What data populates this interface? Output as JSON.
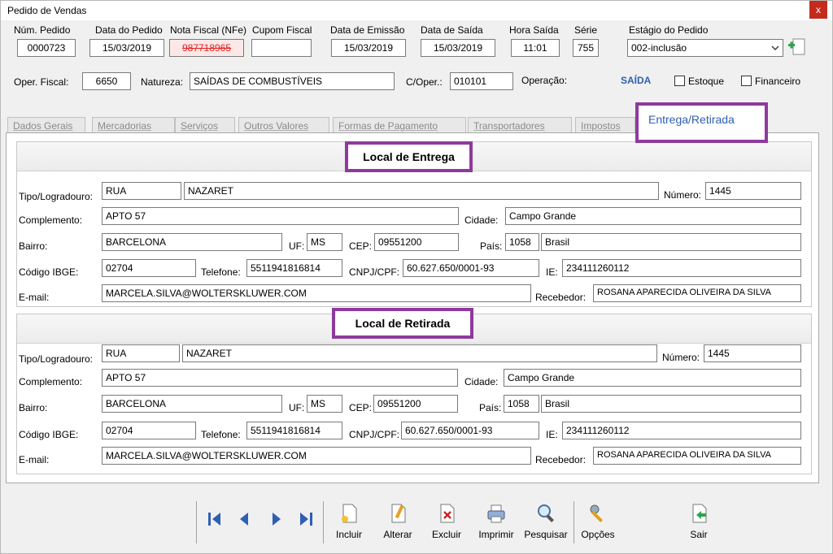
{
  "window": {
    "title": "Pedido de Vendas",
    "close": "x"
  },
  "header": {
    "num_pedido": {
      "label": "Núm. Pedido",
      "value": "0000723"
    },
    "data_pedido": {
      "label": "Data do Pedido",
      "value": "15/03/2019"
    },
    "nota_fiscal": {
      "label": "Nota Fiscal (NFe)",
      "value": "987718965"
    },
    "cupom_fiscal": {
      "label": "Cupom Fiscal",
      "value": ""
    },
    "data_emissao": {
      "label": "Data de Emissão",
      "value": "15/03/2019"
    },
    "data_saida": {
      "label": "Data de Saída",
      "value": "15/03/2019"
    },
    "hora_saida": {
      "label": "Hora Saída",
      "value": "11:01"
    },
    "serie": {
      "label": "Série",
      "value": "755"
    },
    "estagio": {
      "label": "Estágio do Pedido",
      "value": "002-inclusão"
    },
    "oper_fiscal": {
      "label": "Oper. Fiscal:",
      "value": "6650"
    },
    "natureza": {
      "label": "Natureza:",
      "value": "SAÍDAS DE COMBUSTÍVEIS"
    },
    "c_oper": {
      "label": "C/Oper.:",
      "value": "010101"
    },
    "operacao": {
      "label": "Operação:",
      "value": "SAÍDA"
    },
    "estoque": {
      "label": "Estoque",
      "checked": false
    },
    "financeiro": {
      "label": "Financeiro",
      "checked": false
    }
  },
  "tabs": [
    "Dados Gerais",
    "Mercadorias",
    "Serviços",
    "Outros Valores",
    "Formas de Pagamento",
    "Transportadores",
    "Impostos",
    "Entrega/Retirada"
  ],
  "entrega": {
    "title": "Local de Entrega",
    "tipo_label": "Tipo/Logradouro:",
    "tipo": "RUA",
    "logradouro": "NAZARET",
    "numero_label": "Número:",
    "numero": "1445",
    "complemento_label": "Complemento:",
    "complemento": "APTO 57",
    "cidade_label": "Cidade:",
    "cidade": "Campo Grande",
    "bairro_label": "Bairro:",
    "bairro": "BARCELONA",
    "uf_label": "UF:",
    "uf": "MS",
    "cep_label": "CEP:",
    "cep": "09551200",
    "pais_label": "País:",
    "pais_code": "1058",
    "pais": "Brasil",
    "ibge_label": "Código IBGE:",
    "ibge": "02704",
    "telefone_label": "Telefone:",
    "telefone": "5511941816814",
    "cnpj_label": "CNPJ/CPF:",
    "cnpj": "60.627.650/0001-93",
    "ie_label": "IE:",
    "ie": "234111260112",
    "email_label": "E-mail:",
    "email": "MARCELA.SILVA@WOLTERSKLUWER.COM",
    "recebedor_label": "Recebedor:",
    "recebedor": "ROSANA APARECIDA OLIVEIRA DA SILVA"
  },
  "retirada": {
    "title": "Local de Retirada",
    "tipo_label": "Tipo/Logradouro:",
    "tipo": "RUA",
    "logradouro": "NAZARET",
    "numero_label": "Número:",
    "numero": "1445",
    "complemento_label": "Complemento:",
    "complemento": "APTO 57",
    "cidade_label": "Cidade:",
    "cidade": "Campo Grande",
    "bairro_label": "Bairro:",
    "bairro": "BARCELONA",
    "uf_label": "UF:",
    "uf": "MS",
    "cep_label": "CEP:",
    "cep": "09551200",
    "pais_label": "País:",
    "pais_code": "1058",
    "pais": "Brasil",
    "ibge_label": "Código IBGE:",
    "ibge": "02704",
    "telefone_label": "Telefone:",
    "telefone": "5511941816814",
    "cnpj_label": "CNPJ/CPF:",
    "cnpj": "60.627.650/0001-93",
    "ie_label": "IE:",
    "ie": "234111260112",
    "email_label": "E-mail:",
    "email": "MARCELA.SILVA@WOLTERSKLUWER.COM",
    "recebedor_label": "Recebedor:",
    "recebedor": "ROSANA APARECIDA OLIVEIRA DA SILVA"
  },
  "toolbar": {
    "incluir": "Incluir",
    "alterar": "Alterar",
    "excluir": "Excluir",
    "imprimir": "Imprimir",
    "pesquisar": "Pesquisar",
    "opcoes": "Opções",
    "sair": "Sair"
  },
  "colors": {
    "accent_frame": "#8e3a9d",
    "saida_text": "#2f5fb3",
    "nfe_text": "#e02020",
    "close_bg": "#c42b1c"
  },
  "icons": [
    "first-record-icon",
    "previous-record-icon",
    "next-record-icon",
    "last-record-icon",
    "new-document-icon",
    "edit-pencil-icon",
    "delete-document-icon",
    "printer-icon",
    "magnifier-icon",
    "tools-icon",
    "exit-door-icon",
    "add-stage-icon",
    "dropdown-chevron-icon"
  ]
}
